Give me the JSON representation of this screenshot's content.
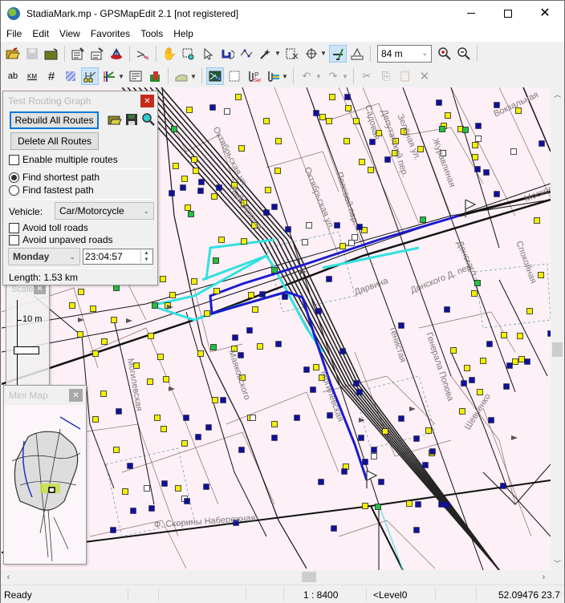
{
  "window": {
    "title": "StadiaMark.mp - GPSMapEdit 2.1 [not registered]",
    "controls": {
      "minimize": "minimize",
      "maximize": "maximize",
      "close": "close"
    }
  },
  "menu": [
    {
      "label": "File",
      "accel": "F"
    },
    {
      "label": "Edit",
      "accel": "E"
    },
    {
      "label": "View",
      "accel": "V"
    },
    {
      "label": "Favorites",
      "accel": "v"
    },
    {
      "label": "Tools",
      "accel": "T"
    },
    {
      "label": "Help",
      "accel": "H"
    }
  ],
  "toolbar1": {
    "icons": [
      "open-icon",
      "save-icon",
      "open-folder-icon",
      "properties-icon",
      "edit-object-icon",
      "map-properties-icon",
      "trace-icon",
      "hand-pan-icon",
      "zoom-rect-icon",
      "select-arrow-icon",
      "rotate-icon",
      "edit-nodes-icon",
      "magic-wand-icon",
      "crop-icon",
      "move-icon",
      "measure-icon",
      "ruler-icon"
    ],
    "scale_value": "84 m",
    "zoom_in": "zoom-in-icon",
    "zoom_out": "zoom-out-icon"
  },
  "toolbar2": {
    "icons": [
      "labels-icon",
      "km-grid-icon",
      "grid-icon",
      "hatch-icon",
      "routing-graph-icon",
      "junction-icon",
      "info-panel-icon",
      "poi-icon",
      "transparent-icon",
      "raster-icon",
      "blank-page-icon",
      "gps-track-icon",
      "attach-icon",
      "undo-icon",
      "redo-icon",
      "cut-icon",
      "copy-icon",
      "paste-icon",
      "delete-icon"
    ]
  },
  "routing_panel": {
    "title": "Test Routing Graph",
    "rebuild_label": "Rebuild All Routes",
    "delete_label": "Delete All Routes",
    "enable_multiple_label": "Enable multiple routes",
    "enable_multiple_checked": false,
    "shortest_label": "Find shortest path",
    "fastest_label": "Find fastest path",
    "selected_mode": "shortest",
    "vehicle_label": "Vehicle:",
    "vehicle_value": "Car/Motorcycle",
    "avoid_toll_label": "Avoid toll roads",
    "avoid_toll_checked": false,
    "avoid_unpaved_label": "Avoid unpaved roads",
    "avoid_unpaved_checked": false,
    "day_value": "Monday",
    "time_value": "23:04:57",
    "length_text": "Length: 1.53 km"
  },
  "scale_panel": {
    "title": "Scale",
    "scale_label": "10 m"
  },
  "minimap_panel": {
    "title": "Mini Map"
  },
  "map": {
    "streets": [
      {
        "name": "Октябрьская ул.",
        "id": "oktyabrskaya-1"
      },
      {
        "name": "Октябрьская ул.",
        "id": "oktyabrskaya-2"
      },
      {
        "name": "Полевой пер.",
        "id": "polevoy"
      },
      {
        "name": "Набережная",
        "id": "naberezhnaya-1"
      },
      {
        "name": "Садовая",
        "id": "sadovaya"
      },
      {
        "name": "Депутатский пер.",
        "id": "deputatsky"
      },
      {
        "name": "Зелёная ул.",
        "id": "zelenaya"
      },
      {
        "name": "Журавлиная",
        "id": "zhuravlinaya"
      },
      {
        "name": "Вокзальная",
        "id": "vokzalnaya"
      },
      {
        "name": "Московская",
        "id": "moskovskaya"
      },
      {
        "name": "Донского",
        "id": "donskogo"
      },
      {
        "name": "Спокойная",
        "id": "spokoynaya"
      },
      {
        "name": "Дарвина",
        "id": "darvina"
      },
      {
        "name": "Донского Д. пер.",
        "id": "donskogo-per"
      },
      {
        "name": "Генерала Попова",
        "id": "popova"
      },
      {
        "name": "Тенистая",
        "id": "tenistaya"
      },
      {
        "name": "Маяковского",
        "id": "mayakovskogo"
      },
      {
        "name": "Могилевская",
        "id": "mogilevskaya"
      },
      {
        "name": "Шевченко",
        "id": "shevchenko"
      },
      {
        "name": "Ф. Скорины Набережная",
        "id": "skoriny"
      }
    ],
    "colors": {
      "background": "#fdf0f7",
      "route": "#1a1ad0",
      "route_alt": "#33e0e0",
      "node_yellow": "#f4f000",
      "node_green": "#22c040",
      "poi_blue": "#10109a"
    }
  },
  "statusbar": {
    "status": "Ready",
    "scale": "1 : 8400",
    "level": "<Level0",
    "coords": "52.09476 23.7"
  }
}
